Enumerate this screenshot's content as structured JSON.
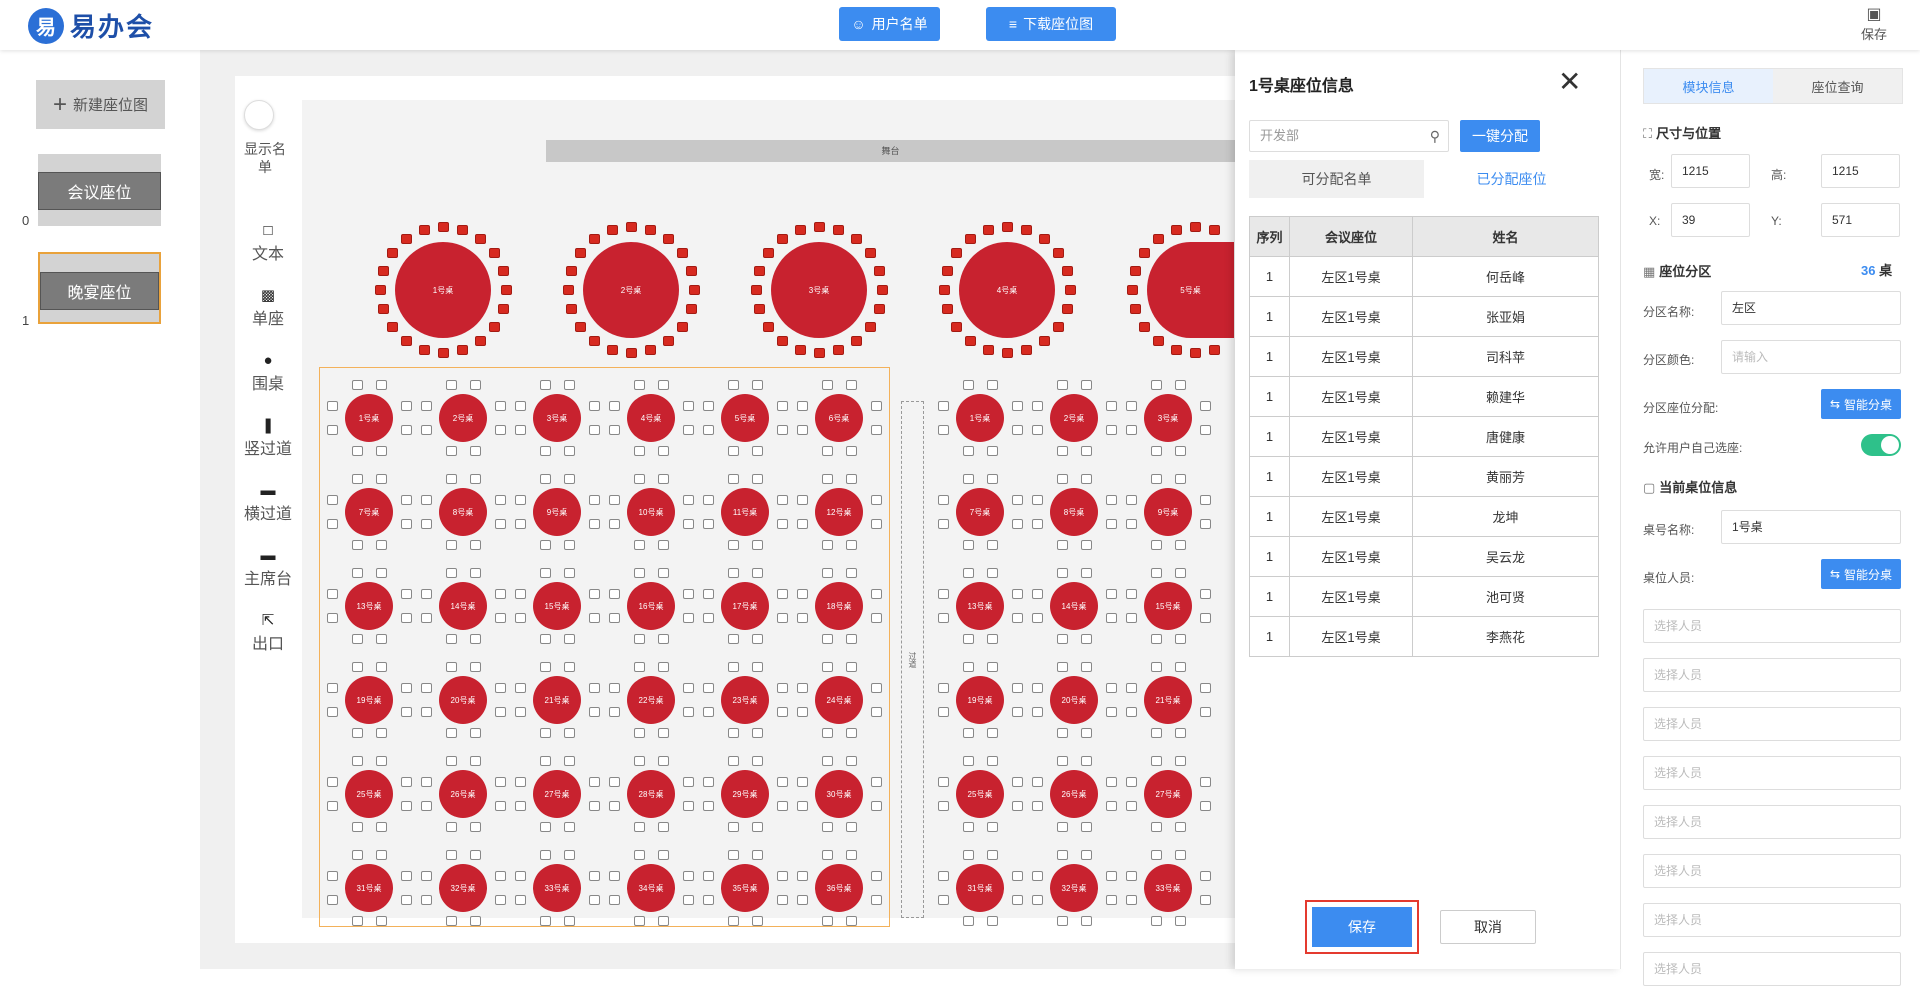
{
  "app": {
    "logo_mark": "易",
    "logo_text": "易办会"
  },
  "toolbar": {
    "user_list": "用户名单",
    "download_map": "下载座位图",
    "save": "保存"
  },
  "left": {
    "new_map": "新建座位图",
    "maps": [
      {
        "label": "会议座位",
        "index": "0"
      },
      {
        "label": "晚宴座位",
        "index": "1"
      }
    ]
  },
  "tools": {
    "show_names": "显示名单",
    "items": [
      {
        "label": "文本",
        "icon": "text-icon"
      },
      {
        "label": "单座",
        "icon": "armchair-icon"
      },
      {
        "label": "围桌",
        "icon": "round-table-icon"
      },
      {
        "label": "竖过道",
        "icon": "vertical-aisle-icon"
      },
      {
        "label": "横过道",
        "icon": "horizontal-aisle-icon"
      },
      {
        "label": "主席台",
        "icon": "podium-icon"
      },
      {
        "label": "出口",
        "icon": "exit-icon"
      }
    ]
  },
  "floor": {
    "stage_label": "舞台",
    "aisle_label": "过道",
    "big_tables": [
      "1号桌",
      "2号桌",
      "3号桌",
      "4号桌",
      "5号桌"
    ],
    "left_tables": [
      "1号桌",
      "2号桌",
      "3号桌",
      "4号桌",
      "5号桌",
      "6号桌",
      "7号桌",
      "8号桌",
      "9号桌",
      "10号桌",
      "11号桌",
      "12号桌",
      "13号桌",
      "14号桌",
      "15号桌",
      "16号桌",
      "17号桌",
      "18号桌",
      "19号桌",
      "20号桌",
      "21号桌",
      "22号桌",
      "23号桌",
      "24号桌",
      "25号桌",
      "26号桌",
      "27号桌",
      "28号桌",
      "29号桌",
      "30号桌",
      "31号桌",
      "32号桌",
      "33号桌",
      "34号桌",
      "35号桌",
      "36号桌"
    ],
    "right_tables": [
      "1号桌",
      "2号桌",
      "3号桌",
      "7号桌",
      "8号桌",
      "9号桌",
      "13号桌",
      "14号桌",
      "15号桌",
      "19号桌",
      "20号桌",
      "21号桌",
      "25号桌",
      "26号桌",
      "27号桌",
      "31号桌",
      "32号桌",
      "33号桌"
    ],
    "colors": {
      "table": "#c8222f",
      "zone_border": "#f3b15a"
    }
  },
  "dialog": {
    "title": "1号桌座位信息",
    "search_placeholder": "开发部",
    "assign_btn": "一键分配",
    "tabs": [
      "可分配名单",
      "已分配座位"
    ],
    "columns": [
      "序列",
      "会议座位",
      "姓名"
    ],
    "rows": [
      [
        "1",
        "左区1号桌",
        "何岳峰"
      ],
      [
        "1",
        "左区1号桌",
        "张亚娟"
      ],
      [
        "1",
        "左区1号桌",
        "司科苹"
      ],
      [
        "1",
        "左区1号桌",
        "赖建华"
      ],
      [
        "1",
        "左区1号桌",
        "唐健康"
      ],
      [
        "1",
        "左区1号桌",
        "黄丽芳"
      ],
      [
        "1",
        "左区1号桌",
        "龙坤"
      ],
      [
        "1",
        "左区1号桌",
        "吴云龙"
      ],
      [
        "1",
        "左区1号桌",
        "池可贤"
      ],
      [
        "1",
        "左区1号桌",
        "李燕花"
      ]
    ],
    "save": "保存",
    "cancel": "取消"
  },
  "right": {
    "tabs": [
      "模块信息",
      "座位查询"
    ],
    "size_title": "尺寸与位置",
    "width_label": "宽:",
    "width": "1215",
    "height_label": "高:",
    "height": "1215",
    "x_label": "X:",
    "x": "39",
    "y_label": "Y:",
    "y": "571",
    "zone_title": "座位分区",
    "zone_count": "36",
    "zone_unit": "桌",
    "zone_name_label": "分区名称:",
    "zone_name": "左区",
    "zone_color_label": "分区颜色:",
    "zone_color_placeholder": "请输入",
    "zone_assign_label": "分区座位分配:",
    "smart_btn": "智能分桌",
    "allow_label": "允许用户自己选座:",
    "table_title": "当前桌位信息",
    "table_name_label": "桌号名称:",
    "table_name": "1号桌",
    "people_label": "桌位人员:",
    "person_placeholder": "选择人员"
  }
}
